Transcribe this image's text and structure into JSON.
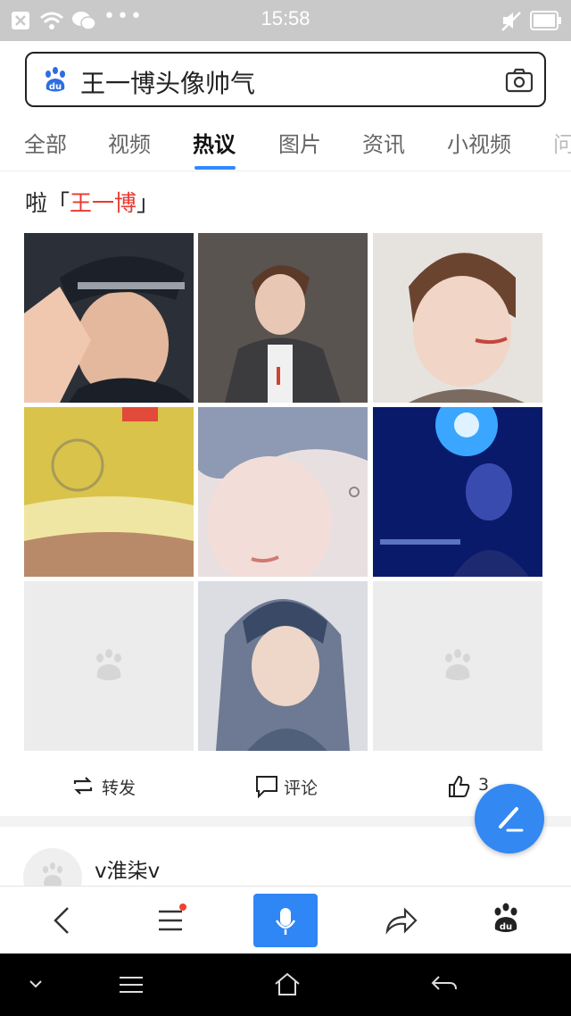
{
  "status_bar": {
    "time": "15:58"
  },
  "search": {
    "query": "王一博头像帅气",
    "logo_icon": "baidu-paw-icon",
    "camera_icon": "camera-icon"
  },
  "tabs": [
    {
      "label": "全部"
    },
    {
      "label": "视频"
    },
    {
      "label": "热议",
      "active": true
    },
    {
      "label": "图片"
    },
    {
      "label": "资讯"
    },
    {
      "label": "小视频"
    },
    {
      "label": "问"
    }
  ],
  "post": {
    "line2_prefix": "啦「",
    "line2_name": "王一博",
    "line2_suffix": "」",
    "images": [
      {
        "desc": "police-cap-salute"
      },
      {
        "desc": "grey-blazer"
      },
      {
        "desc": "smiling-portrait"
      },
      {
        "desc": "yellow-helmet"
      },
      {
        "desc": "blue-hair-earring"
      },
      {
        "desc": "blue-stage-light"
      },
      {
        "desc": "placeholder"
      },
      {
        "desc": "hoodie-portrait"
      },
      {
        "desc": "placeholder"
      }
    ],
    "actions": {
      "share": "转发",
      "comment": "评论",
      "like_count": "3"
    }
  },
  "next_post": {
    "username": "v淮柒v"
  },
  "toolbar": {
    "icons": [
      "back-icon",
      "menu-icon",
      "mic-icon",
      "share-icon",
      "baidu-home-icon"
    ]
  },
  "colors": {
    "accent": "#3388f2",
    "highlight": "#e83a30",
    "status_bar": "#c9c9c9"
  }
}
